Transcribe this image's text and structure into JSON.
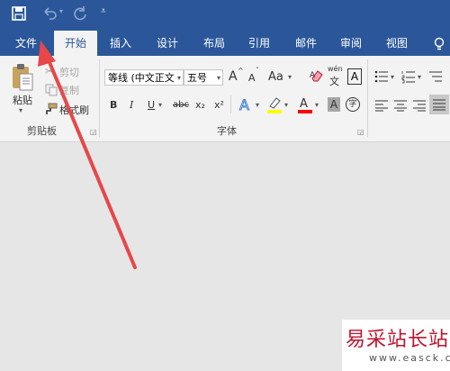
{
  "qat": {
    "save_icon": "save-icon",
    "undo_icon": "undo-icon",
    "redo_icon": "redo-icon",
    "customize_icon": "customize-qat-icon"
  },
  "tabs": [
    "文件",
    "开始",
    "插入",
    "设计",
    "布局",
    "引用",
    "邮件",
    "审阅",
    "视图"
  ],
  "active_tab": "开始",
  "clipboard": {
    "paste_label": "粘贴",
    "cut_label": "剪切",
    "copy_label": "复制",
    "format_painter_label": "格式刷",
    "group_label": "剪贴板"
  },
  "font": {
    "font_name": "等线 (中文正文",
    "font_size": "五号",
    "grow": "A",
    "shrink": "A",
    "change_case": "Aa",
    "bold": "B",
    "italic": "I",
    "underline": "U",
    "strike": "abc",
    "subscript": "x₂",
    "superscript": "x²",
    "group_label": "字体",
    "phonetic_top": "wén",
    "phonetic_bottom": "文",
    "char_border": "A",
    "char_shading": "A",
    "enclose": "字"
  },
  "colors": {
    "accent": "#2b579a",
    "highlight": "#ffff00",
    "font_color": "#ff0000",
    "arrow": "#e8474a",
    "watermark": "#c0142c"
  },
  "watermark": {
    "title": "易采站长站",
    "url": "www.easck.com"
  }
}
